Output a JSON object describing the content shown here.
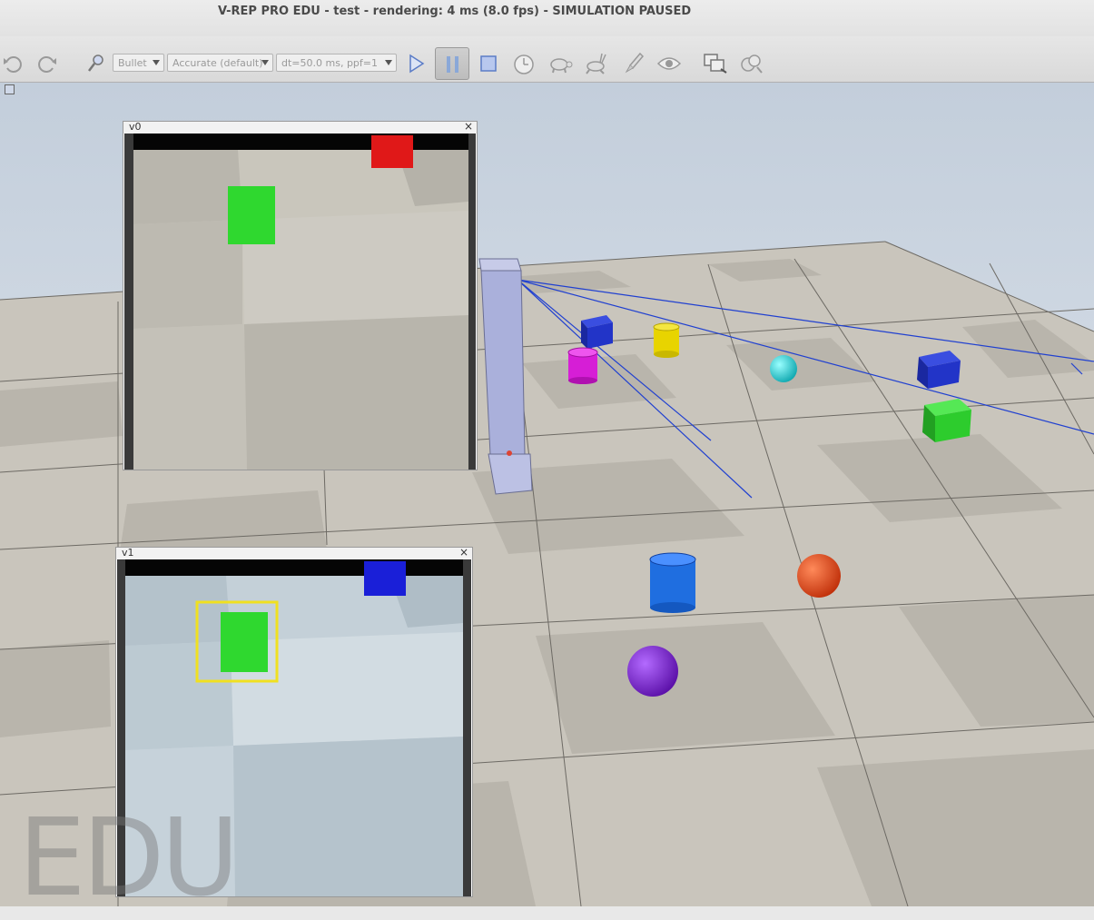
{
  "window": {
    "title": "V-REP PRO EDU - test - rendering: 4 ms (8.0 fps) - SIMULATION PAUSED"
  },
  "toolbar": {
    "undo_icon": "undo-icon",
    "redo_icon": "redo-icon",
    "zoom_icon": "magnifier-icon",
    "engine_combo": "Bullet",
    "accuracy_combo": "Accurate (default)",
    "timestep_combo": "dt=50.0 ms, ppf=1",
    "play_icon": "play-icon",
    "pause_icon": "pause-icon",
    "stop_icon": "stop-icon",
    "realtime_icon": "realtime-clock-icon",
    "slower_icon": "turtle-icon",
    "faster_icon": "rabbit-icon",
    "threaded_icon": "rocket-icon",
    "visualization_icon": "eye-icon",
    "page_icon": "page-selector-icon",
    "scene_icon": "scene-selector-icon",
    "accent": "#8aa8d8"
  },
  "floating_views": [
    {
      "title": "v0",
      "close": "×"
    },
    {
      "title": "v1",
      "close": "×"
    }
  ],
  "watermark": "EDU",
  "colors": {
    "sky_top": "#c4cfdc",
    "sky_bottom": "#e6ebf1",
    "floor_light": "#ccc8bf",
    "floor_dark": "#b7b3aa",
    "sensor_ray": "#2040d0",
    "selection_box": "#f0e020"
  }
}
